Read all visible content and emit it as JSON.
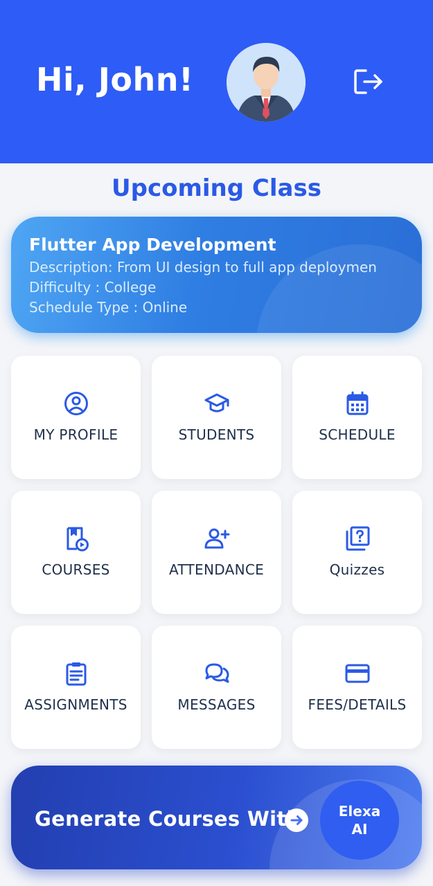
{
  "header": {
    "greeting": "Hi, John!",
    "avatar_icon": "businessman-avatar",
    "logout_icon": "logout-icon",
    "bg_color": "#2e5cf6"
  },
  "upcoming": {
    "section_title": "Upcoming Class",
    "title": "Flutter App Development",
    "description": "Description: From UI design to full app deploymen",
    "difficulty": "Difficulty : College",
    "schedule_type": "Schedule Type : Online"
  },
  "menu": [
    {
      "label": "MY PROFILE",
      "icon": "profile-icon"
    },
    {
      "label": "STUDENTS",
      "icon": "graduation-cap-icon"
    },
    {
      "label": "SCHEDULE",
      "icon": "calendar-icon"
    },
    {
      "label": "COURSES",
      "icon": "course-video-icon"
    },
    {
      "label": "ATTENDANCE",
      "icon": "add-user-icon"
    },
    {
      "label": "Quizzes",
      "icon": "quiz-icon"
    },
    {
      "label": "ASSIGNMENTS",
      "icon": "clipboard-icon"
    },
    {
      "label": "MESSAGES",
      "icon": "chat-icon"
    },
    {
      "label": "FEES/DETAILS",
      "icon": "credit-card-icon"
    }
  ],
  "generate": {
    "label": "Generate Courses With",
    "ai_line1": "Elexa",
    "ai_line2": "AI",
    "arrow_icon": "arrow-right-circle-icon"
  },
  "colors": {
    "accent": "#2a5ae6",
    "icon": "#2a5ae6",
    "tile_text": "#1f2f4b"
  }
}
